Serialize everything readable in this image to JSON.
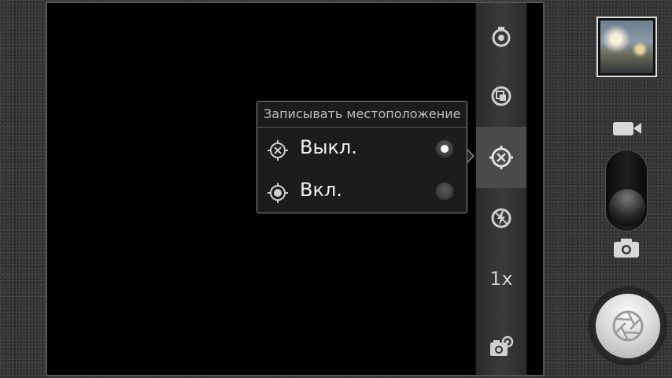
{
  "settings_bar": {
    "zoom_label": "1x",
    "items": [
      {
        "icon": "scene-mode-icon"
      },
      {
        "icon": "exposure-icon"
      },
      {
        "icon": "location-off-icon",
        "selected": true
      },
      {
        "icon": "flash-off-icon"
      },
      {
        "icon": "zoom-label"
      },
      {
        "icon": "camera-settings-icon"
      }
    ]
  },
  "location_popup": {
    "title": "Записывать местоположение",
    "options": [
      {
        "label": "Выкл.",
        "icon": "location-off-icon",
        "checked": true
      },
      {
        "label": "Вкл.",
        "icon": "location-on-icon",
        "checked": false
      }
    ]
  },
  "right_panel": {
    "thumbnail": "last-photo-thumbnail",
    "mode": "photo",
    "icons": [
      "video-camera-icon",
      "camera-icon",
      "shutter-icon"
    ]
  },
  "colors": {
    "background": "#3a3a3a",
    "viewfinder": "#000000",
    "popup_border": "#8c8c8c",
    "text": "#f2f2f2"
  }
}
